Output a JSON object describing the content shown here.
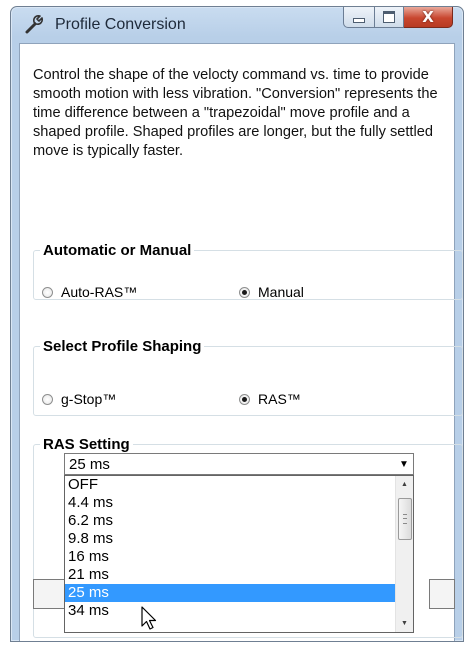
{
  "window": {
    "title": "Profile Conversion",
    "icon": "wrench-icon",
    "controls": [
      "minimize-icon",
      "maximize-icon",
      "close-icon"
    ],
    "close_glyph": "X"
  },
  "description": "Control the shape of the velocty command vs. time to provide smooth motion with less vibration. \"Conversion\" represents the time difference between a \"trapezoidal\" move profile and a shaped profile. Shaped profiles are longer, but the fully settled move is typically faster.",
  "mode_group": {
    "legend": "Automatic or Manual",
    "options": [
      {
        "label": "Auto-RAS™",
        "checked": false
      },
      {
        "label": "Manual",
        "checked": true
      }
    ]
  },
  "shaping_group": {
    "legend": "Select Profile Shaping",
    "options": [
      {
        "label": "g-Stop™",
        "checked": false
      },
      {
        "label": "RAS™",
        "checked": true
      }
    ]
  },
  "ras_group": {
    "legend": "RAS Setting",
    "combo_value": "25 ms",
    "options": [
      "OFF",
      "4.4 ms",
      "6.2 ms",
      "9.8 ms",
      "16 ms",
      "21 ms",
      "25 ms",
      "34 ms"
    ],
    "selected": "25 ms"
  },
  "colors": {
    "selection": "#3399ff",
    "close_button": "#c8472f"
  }
}
